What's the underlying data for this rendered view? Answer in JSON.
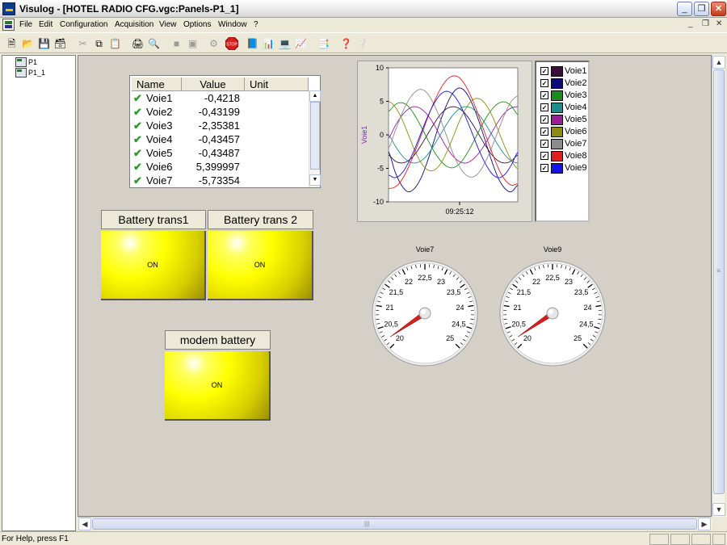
{
  "window": {
    "title": "Visulog - [HOTEL RADIO CFG.vgc:Panels-P1_1]",
    "controls": {
      "minimize": "_",
      "restore": "❐",
      "close": "✕"
    },
    "mdi_controls": {
      "minimize": "_",
      "restore": "❐",
      "close": "✕"
    }
  },
  "menu": [
    "File",
    "Edit",
    "Configuration",
    "Acquisition",
    "View",
    "Options",
    "Window",
    "?"
  ],
  "toolbar": {
    "icons": [
      "new-file-icon",
      "open-folder-icon",
      "save-icon",
      "save-all-icon",
      "cut-icon",
      "copy-icon",
      "paste-icon",
      "print-icon",
      "print-preview-icon",
      "connect-icon",
      "disconnect-icon",
      "stop-icon",
      "book-icon",
      "panel-icon",
      "screen-icon",
      "chart-icon",
      "report-icon",
      "help-icon",
      "context-help-icon"
    ],
    "stop_label": "STOP"
  },
  "tree": {
    "items": [
      "P1",
      "P1_1"
    ]
  },
  "table": {
    "headers": [
      "Name",
      "Value",
      "Unit"
    ],
    "rows": [
      {
        "name": "Voie1",
        "value": "-0,4218"
      },
      {
        "name": "Voie2",
        "value": "-0,43199"
      },
      {
        "name": "Voie3",
        "value": "-2,35381"
      },
      {
        "name": "Voie4",
        "value": "-0,43457"
      },
      {
        "name": "Voie5",
        "value": "-0,43487"
      },
      {
        "name": "Voie6",
        "value": "5,399997"
      },
      {
        "name": "Voie7",
        "value": "-5,73354"
      }
    ]
  },
  "batteries": [
    {
      "label": "Battery trans1",
      "state": "ON"
    },
    {
      "label": "Battery trans 2",
      "state": "ON"
    },
    {
      "label": "modem battery",
      "state": "ON"
    }
  ],
  "chart_data": {
    "type": "line",
    "title": "",
    "xlabel": "09:25:12",
    "ylabel": "Voie1",
    "ylim": [
      -10,
      10
    ],
    "yticks": [
      10,
      5,
      0,
      -5,
      -10
    ],
    "x": [
      0,
      1,
      2,
      3,
      4,
      5,
      6,
      7,
      8,
      9,
      10,
      11,
      12,
      13,
      14,
      15,
      16,
      17,
      18,
      19,
      20
    ],
    "series": [
      {
        "name": "Voie1",
        "color": "#3a0d3a",
        "values": [
          -3.0,
          -3.9,
          -4.2,
          -3.9,
          -3.0,
          -1.6,
          0.0,
          1.6,
          3.0,
          3.9,
          4.2,
          3.9,
          3.0,
          1.6,
          0.0,
          -1.6,
          -3.0,
          -3.9,
          -4.2,
          -3.9,
          -3.0
        ]
      },
      {
        "name": "Voie2",
        "color": "#0a0a7a",
        "values": [
          -2.5,
          -5.5,
          -7.5,
          -8.5,
          -8.0,
          -6.5,
          -4.0,
          -1.0,
          2.0,
          4.5,
          6.3,
          7.0,
          6.3,
          4.5,
          2.0,
          -1.0,
          -4.0,
          -6.5,
          -8.0,
          -8.5,
          -7.5
        ]
      },
      {
        "name": "Voie3",
        "color": "#1c8a1c",
        "values": [
          3.5,
          4.5,
          4.8,
          4.3,
          3.0,
          1.3,
          -0.6,
          -2.4,
          -3.8,
          -4.7,
          -4.9,
          -4.3,
          -3.0,
          -1.3,
          0.6,
          2.4,
          3.8,
          4.7,
          4.9,
          4.3,
          3.0
        ]
      },
      {
        "name": "Voie4",
        "color": "#1e8c8c",
        "values": [
          0.0,
          -1.6,
          -3.0,
          -3.9,
          -4.2,
          -3.9,
          -3.0,
          -1.6,
          0.0,
          1.6,
          3.0,
          3.9,
          4.2,
          3.9,
          3.0,
          1.6,
          0.0,
          -1.6,
          -3.0,
          -3.9,
          -4.2
        ]
      },
      {
        "name": "Voie5",
        "color": "#9a1e9a",
        "values": [
          -0.5,
          1.3,
          2.8,
          3.8,
          4.2,
          3.9,
          3.0,
          1.6,
          -0.2,
          -1.9,
          -3.2,
          -4.0,
          -4.2,
          -3.7,
          -2.7,
          -1.3,
          0.4,
          2.0,
          3.3,
          4.0,
          4.2
        ]
      },
      {
        "name": "Voie6",
        "color": "#8c8c14",
        "values": [
          5.0,
          4.2,
          2.5,
          0.2,
          -2.2,
          -4.1,
          -5.2,
          -5.3,
          -4.4,
          -2.6,
          -0.3,
          2.1,
          4.0,
          5.2,
          5.4,
          4.6,
          2.9,
          0.6,
          -1.8,
          -3.8,
          -5.1
        ]
      },
      {
        "name": "Voie7",
        "color": "#8c8c8c",
        "values": [
          -2.0,
          0.5,
          3.0,
          5.0,
          6.3,
          6.8,
          6.2,
          4.6,
          2.4,
          -0.2,
          -2.8,
          -4.8,
          -6.0,
          -6.3,
          -5.6,
          -4.0,
          -1.8,
          0.7,
          3.1,
          5.0,
          5.8
        ]
      },
      {
        "name": "Voie8",
        "color": "#e01e1e",
        "values": [
          -8.0,
          -7.8,
          -6.8,
          -5.0,
          -2.7,
          -0.2,
          2.4,
          4.8,
          6.8,
          8.2,
          8.8,
          8.5,
          7.2,
          5.2,
          2.7,
          0.0,
          -2.6,
          -5.0,
          -6.7,
          -7.5,
          -7.3
        ]
      },
      {
        "name": "Voie9",
        "color": "#1414e6",
        "values": [
          -6.0,
          -6.4,
          -5.8,
          -4.3,
          -2.2,
          0.2,
          2.6,
          4.6,
          6.0,
          6.5,
          6.0,
          4.6,
          2.5,
          0.1,
          -2.3,
          -4.3,
          -5.8,
          -6.4,
          -5.9,
          -4.5,
          -2.6
        ]
      }
    ]
  },
  "gauges": [
    {
      "title": "Voie7",
      "min": 20,
      "max": 25,
      "labels": [
        "20",
        "20,5",
        "21",
        "21,5",
        "22",
        "22,5",
        "23",
        "23,5",
        "24",
        "24,5",
        "25"
      ],
      "value": 20.2
    },
    {
      "title": "Voie9",
      "min": 20,
      "max": 25,
      "labels": [
        "20",
        "20,5",
        "21",
        "21,5",
        "22",
        "22,5",
        "23",
        "23,5",
        "24",
        "24,5",
        "25"
      ],
      "value": 20.2
    }
  ],
  "status": {
    "text": "For Help, press F1"
  }
}
